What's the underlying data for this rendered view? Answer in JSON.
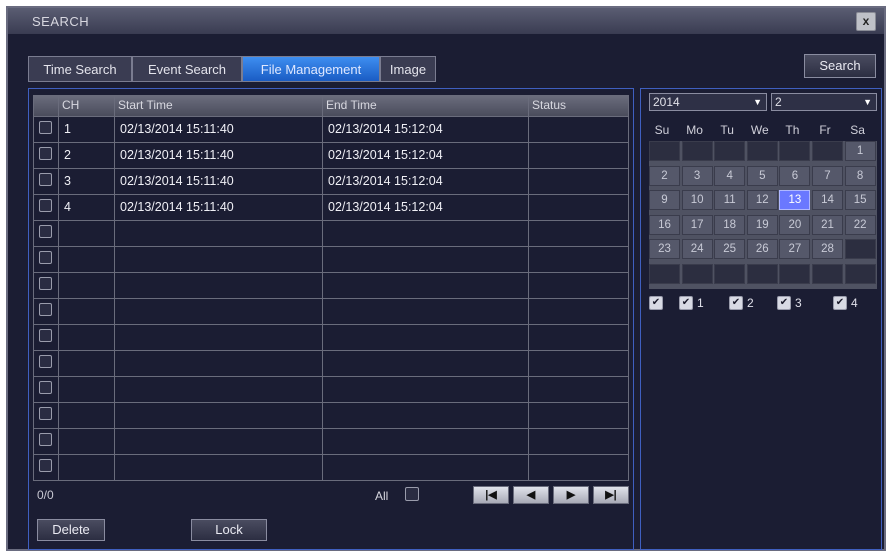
{
  "window": {
    "title": "SEARCH",
    "close_label": "x"
  },
  "tabs": [
    {
      "label": "Time Search"
    },
    {
      "label": "Event Search"
    },
    {
      "label": "File Management"
    },
    {
      "label": "Image"
    }
  ],
  "active_tab": "File Management",
  "search_button": "Search",
  "table": {
    "columns": [
      "CH",
      "Start Time",
      "End Time",
      "Status"
    ],
    "rows": [
      {
        "ch": "1",
        "start": "02/13/2014 15:11:40",
        "end": "02/13/2014 15:12:04",
        "status": ""
      },
      {
        "ch": "2",
        "start": "02/13/2014 15:11:40",
        "end": "02/13/2014 15:12:04",
        "status": ""
      },
      {
        "ch": "3",
        "start": "02/13/2014 15:11:40",
        "end": "02/13/2014 15:12:04",
        "status": ""
      },
      {
        "ch": "4",
        "start": "02/13/2014 15:11:40",
        "end": "02/13/2014 15:12:04",
        "status": ""
      }
    ]
  },
  "footer": {
    "count": "0/0",
    "all_label": "All"
  },
  "buttons": {
    "delete": "Delete",
    "lock": "Lock"
  },
  "calendar": {
    "year": "2014",
    "month": "2",
    "weekdays": [
      "Su",
      "Mo",
      "Tu",
      "We",
      "Th",
      "Fr",
      "Sa"
    ],
    "days": [
      "1",
      "2",
      "3",
      "4",
      "5",
      "6",
      "7",
      "8",
      "9",
      "10",
      "11",
      "12",
      "13",
      "14",
      "15",
      "16",
      "17",
      "18",
      "19",
      "20",
      "21",
      "22",
      "23",
      "24",
      "25",
      "26",
      "27",
      "28"
    ],
    "selected_day": "13",
    "channels": [
      "",
      "1",
      "2",
      "3",
      "4"
    ]
  },
  "icons": {
    "nav": [
      "first-page-icon",
      "prev-page-icon",
      "next-page-icon",
      "last-page-icon"
    ]
  },
  "colors": {
    "active_tab": "#1a5cc4",
    "selected_day": "#6a78ff",
    "panel_border": "#3f5fc0"
  }
}
